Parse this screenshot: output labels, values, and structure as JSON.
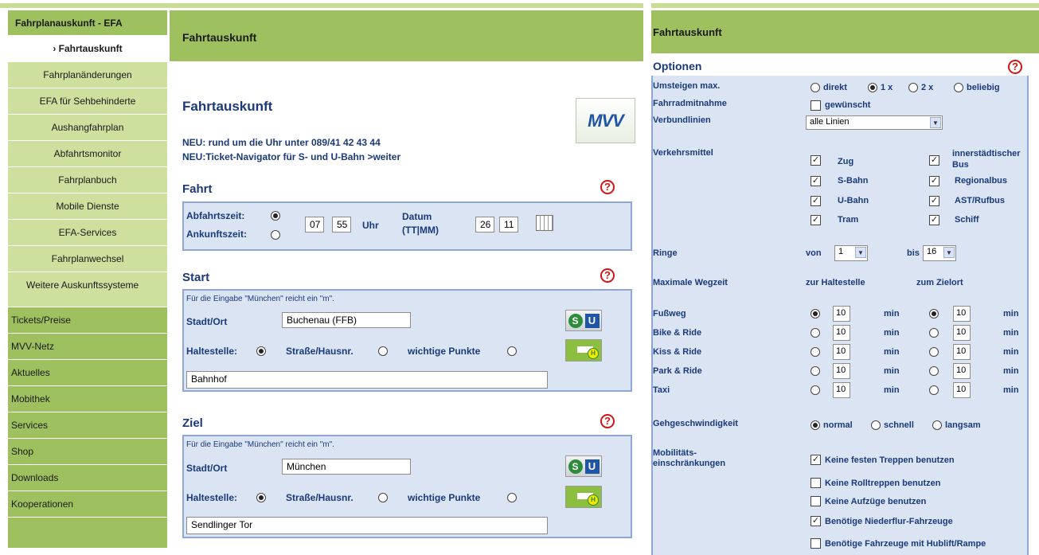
{
  "sidebar": {
    "header": "Fahrplanauskunft - EFA",
    "items": [
      "› Fahrtauskunft",
      "Fahrplanänderungen",
      "EFA für Sehbehinderte",
      "Aushangfahrplan",
      "Abfahrtsmonitor",
      "Fahrplanbuch",
      "Mobile Dienste",
      "EFA-Services",
      "Fahrplanwechsel",
      "Weitere Auskunftssysteme"
    ],
    "main": [
      "Tickets/Preise",
      "MVV-Netz",
      "Aktuelles",
      "Mobithek",
      "Services",
      "Shop",
      "Downloads",
      "Kooperationen"
    ]
  },
  "middle": {
    "banner": "Fahrtauskunft",
    "title": "Fahrtauskunft",
    "news1": "NEU: rund um die Uhr unter 089/41 42 43 44",
    "news2": "NEU:Ticket-Navigator für S- und U-Bahn >weiter",
    "logo": "MVV",
    "fahrt": {
      "heading": "Fahrt",
      "abfahrt": "Abfahrtszeit:",
      "ankunft": "Ankunftszeit:",
      "hour": "07",
      "minute": "55",
      "uhr": "Uhr",
      "datum": "Datum",
      "datum_fmt": "(TT|MM)",
      "day": "26",
      "month": "11"
    },
    "start": {
      "heading": "Start",
      "hint": "Für die Eingabe \"München\" reicht ein \"m\".",
      "city_label": "Stadt/Ort",
      "city": "Buchenau (FFB)",
      "haltestelle": "Haltestelle:",
      "strasse": "Straße/Hausnr.",
      "punkte": "wichtige Punkte",
      "stop": "Bahnhof"
    },
    "ziel": {
      "heading": "Ziel",
      "hint": "Für die Eingabe \"München\" reicht ein \"m\".",
      "city_label": "Stadt/Ort",
      "city": "München",
      "haltestelle": "Haltestelle:",
      "strasse": "Straße/Hausnr.",
      "punkte": "wichtige Punkte",
      "stop": "Sendlinger Tor"
    },
    "help": "?",
    "s": "S",
    "u": "U"
  },
  "right": {
    "banner": "Fahrtauskunft",
    "options": "Optionen",
    "umsteigen": {
      "label": "Umsteigen max.",
      "opts": [
        "direkt",
        "1 x",
        "2 x",
        "beliebig"
      ]
    },
    "fahrrad": {
      "label": "Fahrradmitnahme",
      "opt": "gewünscht"
    },
    "verbund": {
      "label": "Verbundlinien",
      "value": "alle Linien"
    },
    "verkehr": {
      "label": "Verkehrsmittel",
      "items": [
        "Zug",
        "innerstädtischer Bus",
        "S-Bahn",
        "Regionalbus",
        "U-Bahn",
        "AST/Rufbus",
        "Tram",
        "Schiff"
      ]
    },
    "ringe": {
      "label": "Ringe",
      "von": "von",
      "von_val": "1",
      "bis": "bis",
      "bis_val": "16"
    },
    "wegzeit": {
      "label": "Maximale Wegzeit",
      "h1": "zur Haltestelle",
      "h2": "zum Zielort"
    },
    "modes": [
      {
        "name": "Fußweg",
        "v1": "10",
        "v2": "10"
      },
      {
        "name": "Bike & Ride",
        "v1": "10",
        "v2": "10"
      },
      {
        "name": "Kiss & Ride",
        "v1": "10",
        "v2": "10"
      },
      {
        "name": "Park & Ride",
        "v1": "10",
        "v2": "10"
      },
      {
        "name": "Taxi",
        "v1": "10",
        "v2": "10"
      }
    ],
    "min": "min",
    "geh": {
      "label": "Gehgeschwindigkeit",
      "opts": [
        "normal",
        "schnell",
        "langsam"
      ]
    },
    "mob": {
      "label1": "Mobilitäts-",
      "label2": "einschränkungen",
      "opts": [
        "Keine festen Treppen benutzen",
        "Keine Rolltreppen benutzen",
        "Keine Aufzüge benutzen",
        "Benötige Niederflur-Fahrzeuge",
        "Benötige Fahrzeuge mit Hublift/Rampe"
      ]
    },
    "checked": "✓"
  }
}
